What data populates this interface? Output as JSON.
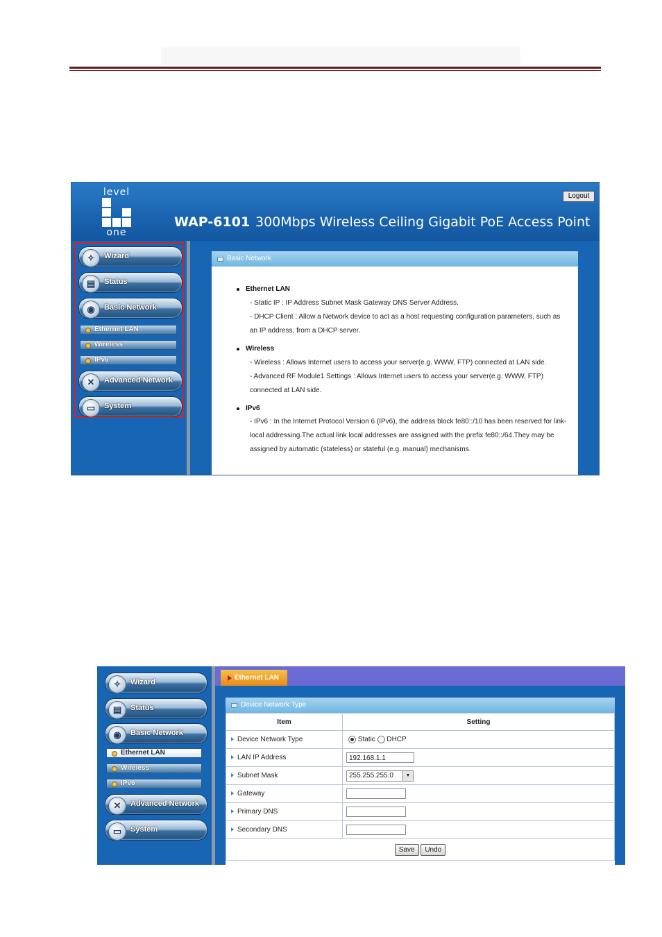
{
  "shot1": {
    "logo": {
      "top": "level",
      "bottom": "one"
    },
    "model": "WAP-6101",
    "tagline": "300Mbps Wireless Ceiling Gigabit PoE Access Point",
    "logout": "Logout",
    "nav": {
      "wizard": "Wizard",
      "status": "Status",
      "basic": "Basic Network",
      "sub": [
        "Ethernet LAN",
        "Wireless",
        "IPv6"
      ],
      "advanced": "Advanced Network",
      "system": "System"
    },
    "panel_title": "Basic Network",
    "sections": [
      {
        "heading": "Ethernet LAN",
        "lines": [
          "- Static IP : IP Address Subnet Mask Gateway DNS Server Address.",
          "- DHCP Client : Allow a Network device to act as a host requesting configuration parameters, such as",
          "an IP address, from a DHCP server."
        ]
      },
      {
        "heading": "Wireless",
        "lines": [
          "- Wireless : Allows Internet users to access your server(e.g. WWW, FTP) connected at LAN side.",
          "- Advanced RF Module1 Settings : Allows Internet users to access your server(e.g. WWW, FTP)",
          "connected at LAN side."
        ]
      },
      {
        "heading": "IPv6",
        "lines": [
          "- IPv6 : In the Internet Protocol Version 6 (IPv6), the address block fe80::/10 has been reserved for link-",
          "local addressing.The actual link local addresses are assigned with the prefix fe80::/64.They may be",
          "assigned by automatic (stateless) or stateful (e.g. manual) mechanisms."
        ]
      }
    ]
  },
  "shot2": {
    "nav": {
      "wizard": "Wizard",
      "status": "Status",
      "basic": "Basic Network",
      "sub": [
        "Ethernet LAN",
        "Wireless",
        "IPv6"
      ],
      "advanced": "Advanced Network",
      "system": "System"
    },
    "tab": "Ethernet LAN",
    "panel_title": "Device Network Type",
    "col_item": "Item",
    "col_setting": "Setting",
    "rows": {
      "type": "Device Network Type",
      "lan_ip": "LAN IP Address",
      "mask": "Subnet Mask",
      "gateway": "Gateway",
      "dns1": "Primary DNS",
      "dns2": "Secondary DNS"
    },
    "radio_static": "Static",
    "radio_dhcp": "DHCP",
    "lan_ip_value": "192.168.1.1",
    "mask_value": "255.255.255.0",
    "save": "Save",
    "undo": "Undo"
  }
}
